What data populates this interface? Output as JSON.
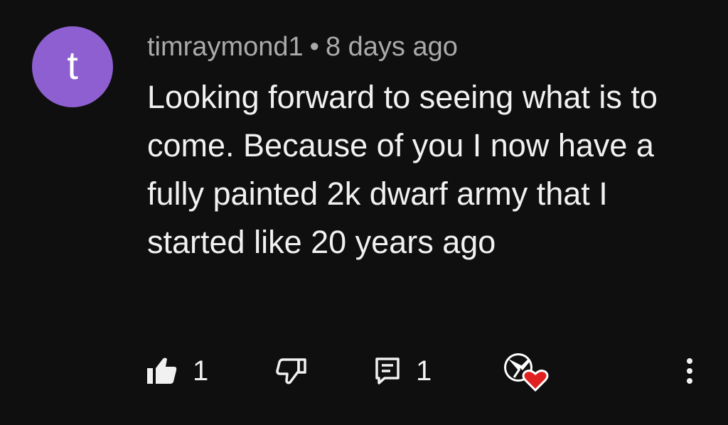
{
  "comment": {
    "avatar_letter": "t",
    "avatar_color": "#8e5fd1",
    "author": "timraymond1",
    "separator": "•",
    "time_ago": "8 days ago",
    "text": "Looking forward to seeing what is to come. Because of you I now have a fully painted 2k dwarf army that I started like 20 years ago",
    "like_count": "1",
    "reply_count": "1"
  },
  "icons": {
    "like": "thumbs-up-icon",
    "dislike": "thumbs-down-icon",
    "reply": "comment-reply-icon",
    "creator_heart": "creator-heart-icon",
    "more": "more-vertical-icon"
  },
  "colors": {
    "background": "#0f0f0f",
    "heart": "#e02020"
  }
}
